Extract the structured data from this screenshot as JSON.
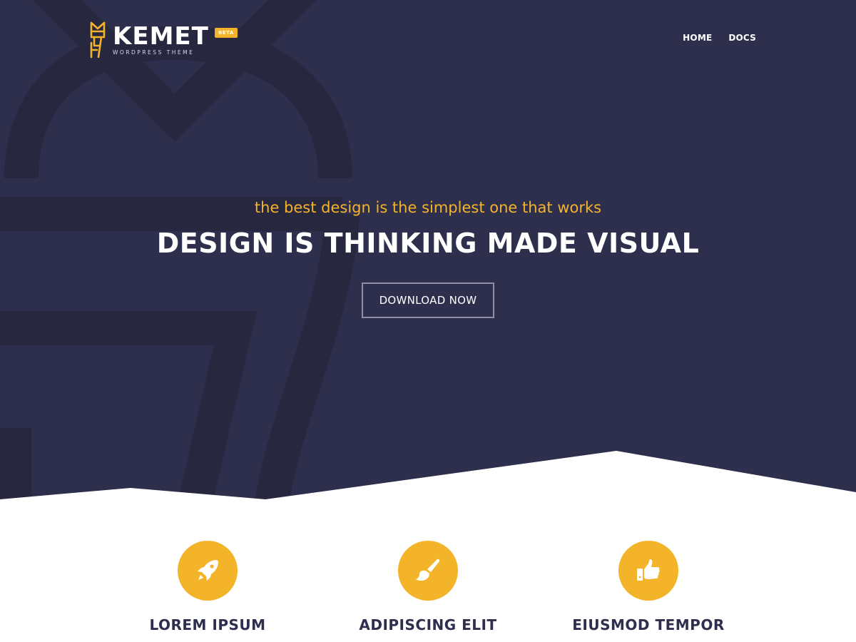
{
  "header": {
    "logo": {
      "name": "KEMET",
      "badge": "BETA",
      "tagline": "WORDPRESS THEME",
      "icon": "kemet-pharaoh-icon"
    },
    "nav": [
      {
        "label": "HOME"
      },
      {
        "label": "DOCS"
      }
    ]
  },
  "hero": {
    "tagline": "the best design is the simplest one that works",
    "title": "DESIGN IS THINKING MADE VISUAL",
    "button_label": "DOWNLOAD NOW"
  },
  "features": [
    {
      "title": "LOREM IPSUM",
      "icon": "rocket-icon"
    },
    {
      "title": "ADIPISCING ELIT",
      "icon": "paintbrush-icon"
    },
    {
      "title": "EIUSMOD TEMPOR",
      "icon": "thumbs-up-icon"
    }
  ],
  "colors": {
    "hero_background": "#2e2e4d",
    "accent": "#f4b42a",
    "text_dark": "#2e2e4d",
    "white": "#ffffff"
  }
}
